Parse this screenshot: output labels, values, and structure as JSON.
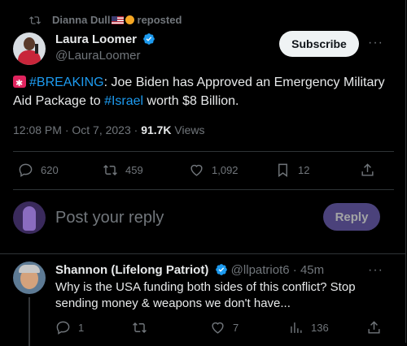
{
  "repost": {
    "user": "Dianna Dull",
    "label": "reposted"
  },
  "author": {
    "name": "Laura Loomer",
    "handle": "@LauraLoomer"
  },
  "subscribe_label": "Subscribe",
  "more_label": "···",
  "tweet": {
    "emoji": "siren",
    "hashtag1": "#BREAKING",
    "text1": ": Joe Biden has Approved an Emergency Military Aid Package to ",
    "hashtag2": "#Israel",
    "text2": " worth $8 Billion.",
    "time": "12:08 PM · Oct 7, 2023 · ",
    "views_count": "91.7K",
    "views_label": " Views"
  },
  "actions": {
    "replies": "620",
    "reposts": "459",
    "likes": "1,092",
    "bookmarks": "12"
  },
  "compose": {
    "placeholder": "Post your reply",
    "button": "Reply"
  },
  "reply": {
    "name": "Shannon (Lifelong Patriot)",
    "handle": "@llpatriot6",
    "time": " · 45m",
    "text": "Why is the USA funding both sides of this conflict? Stop sending money & weapons we don't have...",
    "replies": "1",
    "likes": "7",
    "views": "136"
  },
  "colors": {
    "accent": "#1d9bf0",
    "background": "#000000",
    "muted": "#71767b",
    "reply_button": "#6b5fb0"
  },
  "icons": [
    "repost-icon",
    "verified-icon",
    "more-icon",
    "reply-icon",
    "like-icon",
    "bookmark-icon",
    "share-icon",
    "views-icon"
  ]
}
